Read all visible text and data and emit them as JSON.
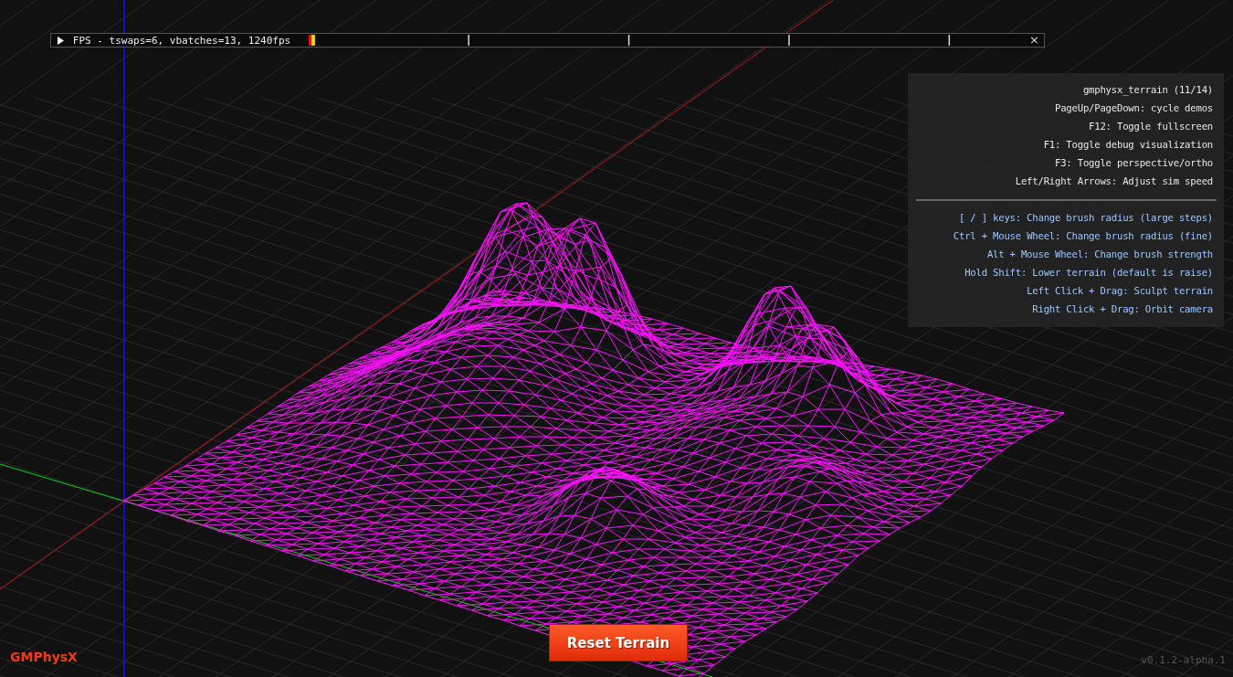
{
  "fps_window": {
    "expanded": false,
    "title": "FPS - tswaps=6, vbatches=13, 1240fps",
    "close": "×"
  },
  "help_panel": {
    "general": [
      "gmphysx_terrain (11/14)",
      "PageUp/PageDown: cycle demos",
      "F12: Toggle fullscreen",
      "F1: Toggle debug visualization",
      "F3: Toggle perspective/ortho",
      "Left/Right Arrows: Adjust sim speed"
    ],
    "controls": [
      "[ / ] keys: Change brush radius (large steps)",
      "Ctrl + Mouse Wheel: Change brush radius (fine)",
      "Alt + Mouse Wheel: Change brush strength",
      "Hold Shift: Lower terrain (default is raise)",
      "Left Click + Drag: Sculpt terrain",
      "Right Click + Drag: Orbit camera"
    ]
  },
  "reset_button": "Reset Terrain",
  "logo": "GMPhysX",
  "version": "v0.1.2-alpha.1"
}
